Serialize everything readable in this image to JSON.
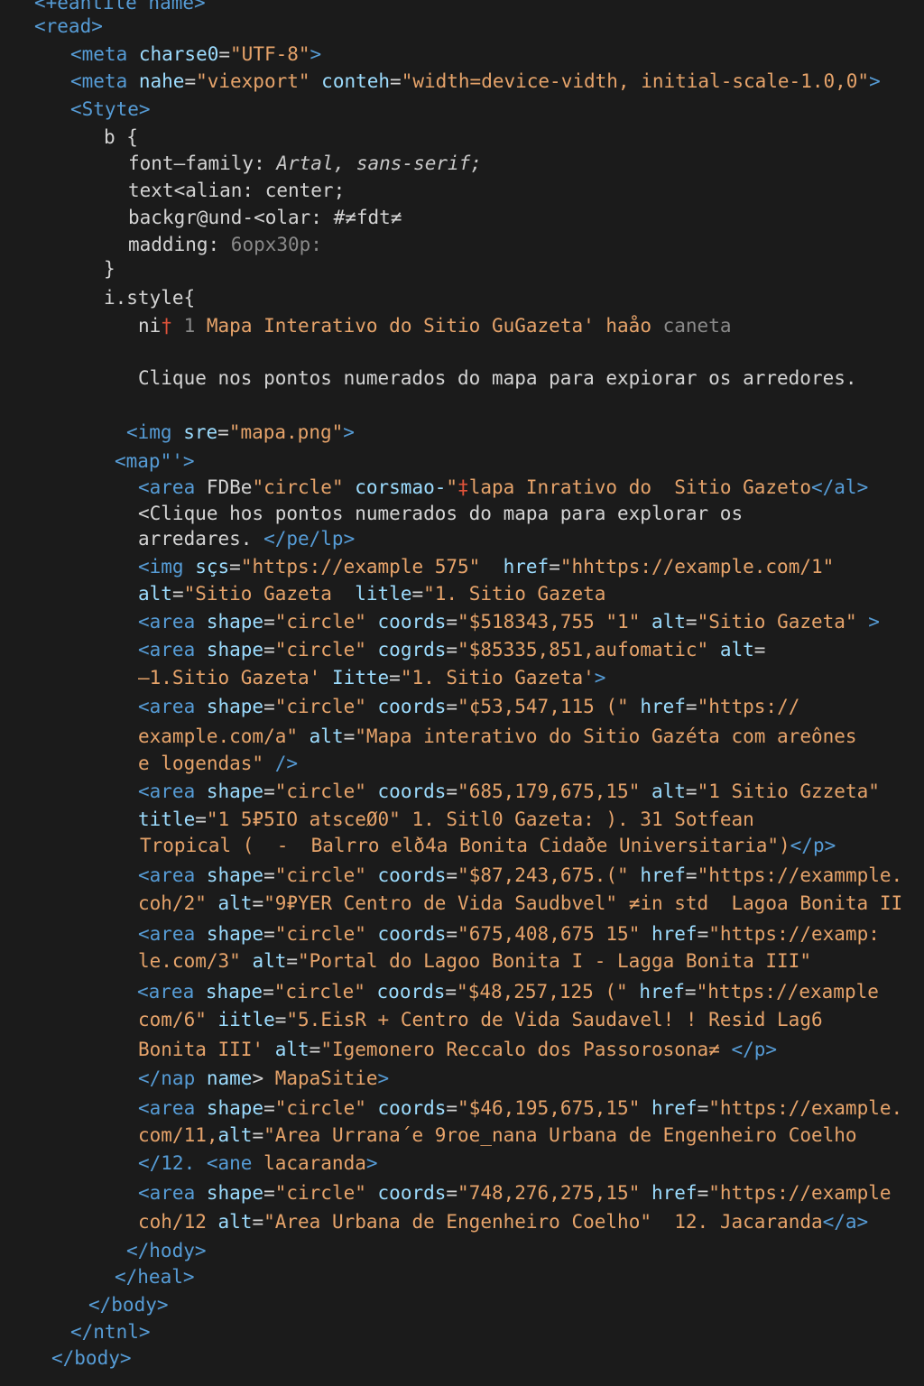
{
  "editor": {
    "lines": [
      {
        "segs": [
          {
            "c": "t",
            "t": "<+eantile name>"
          }
        ]
      },
      {
        "segs": [
          {
            "c": "t",
            "t": "<read>"
          }
        ]
      },
      {
        "segs": [
          {
            "c": "t",
            "t": "<meta "
          },
          {
            "c": "a",
            "t": "charse0"
          },
          {
            "c": "p",
            "t": "="
          },
          {
            "c": "s",
            "t": "\"UTF-8\""
          },
          {
            "c": "t",
            "t": ">"
          }
        ]
      },
      {
        "segs": [
          {
            "c": "t",
            "t": "<meta "
          },
          {
            "c": "a",
            "t": "nahe"
          },
          {
            "c": "p",
            "t": "="
          },
          {
            "c": "s",
            "t": "\"viexport\" "
          },
          {
            "c": "a",
            "t": "conteh"
          },
          {
            "c": "p",
            "t": "="
          },
          {
            "c": "s",
            "t": "\"width=device-vidth, initial-scale-1.0,0\""
          },
          {
            "c": "t",
            "t": ">"
          }
        ]
      },
      {
        "segs": [
          {
            "c": "t",
            "t": "<Styte>"
          }
        ]
      },
      {
        "segs": [
          {
            "c": "p",
            "t": "b {"
          }
        ]
      },
      {
        "segs": [
          {
            "c": "p",
            "t": "font—family: "
          },
          {
            "c": "i",
            "t": "Artal, sans-serif;"
          }
        ]
      },
      {
        "segs": [
          {
            "c": "p",
            "t": "text<alian: center;"
          }
        ]
      },
      {
        "segs": [
          {
            "c": "p",
            "t": "backgr@und-<olar: #≠fdt≠"
          }
        ]
      },
      {
        "segs": [
          {
            "c": "p",
            "t": "madding: "
          },
          {
            "c": "g",
            "t": "6opx30p:"
          }
        ]
      },
      {
        "segs": [
          {
            "c": "p",
            "t": "}"
          }
        ]
      },
      {
        "segs": [
          {
            "c": "p",
            "t": "i.style{"
          }
        ]
      },
      {
        "segs": [
          {
            "c": "p",
            "t": "ni"
          },
          {
            "c": "r",
            "t": "†"
          },
          {
            "c": "g",
            "t": " 1 "
          },
          {
            "c": "s",
            "t": "Mapa Interativo do Sitio GuGazeta' haåo "
          },
          {
            "c": "g",
            "t": "caneta"
          }
        ]
      },
      {
        "segs": [
          {
            "c": "p",
            "t": "Clique nos pontos numerados do mapa para expiorar os arredores."
          }
        ]
      },
      {
        "segs": [
          {
            "c": "t",
            "t": "<img "
          },
          {
            "c": "a",
            "t": "sre"
          },
          {
            "c": "p",
            "t": "="
          },
          {
            "c": "s",
            "t": "\"mapa.png\""
          },
          {
            "c": "t",
            "t": ">"
          }
        ]
      },
      {
        "segs": [
          {
            "c": "t",
            "t": "<map\"'>"
          }
        ]
      },
      {
        "segs": [
          {
            "c": "t",
            "t": "<area "
          },
          {
            "c": "p",
            "t": "FDBe"
          },
          {
            "c": "s",
            "t": "\"circle\" "
          },
          {
            "c": "a",
            "t": "corsmao-"
          },
          {
            "c": "s",
            "t": "\""
          },
          {
            "c": "r",
            "t": "‡"
          },
          {
            "c": "s",
            "t": "lapa Inrativo do  Sitio Gazeto"
          },
          {
            "c": "t",
            "t": "</al>"
          }
        ]
      },
      {
        "segs": [
          {
            "c": "p",
            "t": "<Clique hos pontos numerados do mapa para explorar os"
          }
        ]
      },
      {
        "segs": [
          {
            "c": "p",
            "t": "arredares. "
          },
          {
            "c": "t",
            "t": "</pe/lp>"
          }
        ]
      },
      {
        "segs": [
          {
            "c": "t",
            "t": "<img "
          },
          {
            "c": "a",
            "t": "sçs"
          },
          {
            "c": "p",
            "t": "="
          },
          {
            "c": "s",
            "t": "\"https://example 575\"  "
          },
          {
            "c": "a",
            "t": "href"
          },
          {
            "c": "p",
            "t": "="
          },
          {
            "c": "s",
            "t": "\"hhttps://example.com/1\""
          }
        ]
      },
      {
        "segs": [
          {
            "c": "a",
            "t": "alt"
          },
          {
            "c": "p",
            "t": "="
          },
          {
            "c": "s",
            "t": "\"Sitio Gazeta  "
          },
          {
            "c": "a",
            "t": "litle"
          },
          {
            "c": "p",
            "t": "="
          },
          {
            "c": "s",
            "t": "\"1. Sitio Gazeta"
          }
        ]
      },
      {
        "segs": [
          {
            "c": "t",
            "t": "<area "
          },
          {
            "c": "a",
            "t": "shape"
          },
          {
            "c": "p",
            "t": "="
          },
          {
            "c": "s",
            "t": "\"circle\" "
          },
          {
            "c": "a",
            "t": "coords"
          },
          {
            "c": "p",
            "t": "="
          },
          {
            "c": "s",
            "t": "\"$518343,755 \"1\" "
          },
          {
            "c": "a",
            "t": "alt"
          },
          {
            "c": "p",
            "t": "="
          },
          {
            "c": "s",
            "t": "\"Sitio Gazeta\" "
          },
          {
            "c": "t",
            "t": ">"
          }
        ]
      },
      {
        "segs": [
          {
            "c": "t",
            "t": "<area "
          },
          {
            "c": "a",
            "t": "shape"
          },
          {
            "c": "p",
            "t": "="
          },
          {
            "c": "s",
            "t": "\"circle\" "
          },
          {
            "c": "a",
            "t": "cogrds"
          },
          {
            "c": "p",
            "t": "="
          },
          {
            "c": "s",
            "t": "\"$85335,851,aufomatic\" "
          },
          {
            "c": "a",
            "t": "alt"
          },
          {
            "c": "p",
            "t": "="
          }
        ]
      },
      {
        "segs": [
          {
            "c": "s",
            "t": "–1.Sitio Gazeta' "
          },
          {
            "c": "a",
            "t": "Iitte"
          },
          {
            "c": "p",
            "t": "="
          },
          {
            "c": "s",
            "t": "\"1. Sitio Gazeta'"
          },
          {
            "c": "t",
            "t": ">"
          }
        ]
      },
      {
        "segs": [
          {
            "c": "t",
            "t": "<area "
          },
          {
            "c": "a",
            "t": "shape"
          },
          {
            "c": "p",
            "t": "="
          },
          {
            "c": "s",
            "t": "\"circle\" "
          },
          {
            "c": "a",
            "t": "coords"
          },
          {
            "c": "p",
            "t": "="
          },
          {
            "c": "s",
            "t": "\"¢53,547,115 (\" "
          },
          {
            "c": "a",
            "t": "href"
          },
          {
            "c": "p",
            "t": "="
          },
          {
            "c": "s",
            "t": "\"https://"
          }
        ]
      },
      {
        "segs": [
          {
            "c": "s",
            "t": "example.com/a\" "
          },
          {
            "c": "a",
            "t": "alt"
          },
          {
            "c": "p",
            "t": "="
          },
          {
            "c": "s",
            "t": "\"Mapa interativo do Sitio Gazéta com areônes"
          }
        ]
      },
      {
        "segs": [
          {
            "c": "s",
            "t": "e logendas\" "
          },
          {
            "c": "t",
            "t": "/>"
          }
        ]
      },
      {
        "segs": [
          {
            "c": "t",
            "t": "<area "
          },
          {
            "c": "a",
            "t": "shape"
          },
          {
            "c": "p",
            "t": "="
          },
          {
            "c": "s",
            "t": "\"circle\" "
          },
          {
            "c": "a",
            "t": "coords"
          },
          {
            "c": "p",
            "t": "="
          },
          {
            "c": "s",
            "t": "\"685,179,675,15\" "
          },
          {
            "c": "a",
            "t": "alt"
          },
          {
            "c": "p",
            "t": "="
          },
          {
            "c": "s",
            "t": "\"1 Sitio Gzzeta\""
          }
        ]
      },
      {
        "segs": [
          {
            "c": "a",
            "t": "title"
          },
          {
            "c": "p",
            "t": "="
          },
          {
            "c": "s",
            "t": "\"1 5₽5IO atsceØ0\" 1. Sitl0 Gazeta: ). 31 Sotfean"
          }
        ]
      },
      {
        "segs": [
          {
            "c": "s",
            "t": "Tropical (  -  Balrro elð4a Bonita Cidaðe Universitaria\")"
          },
          {
            "c": "t",
            "t": "</p>"
          }
        ]
      },
      {
        "segs": [
          {
            "c": "t",
            "t": "<area "
          },
          {
            "c": "a",
            "t": "shape"
          },
          {
            "c": "p",
            "t": "="
          },
          {
            "c": "s",
            "t": "\"circle\" "
          },
          {
            "c": "a",
            "t": "coords"
          },
          {
            "c": "p",
            "t": "="
          },
          {
            "c": "s",
            "t": "\"$87,243,675.(\" "
          },
          {
            "c": "a",
            "t": "href"
          },
          {
            "c": "p",
            "t": "="
          },
          {
            "c": "s",
            "t": "\"https://exammple."
          }
        ]
      },
      {
        "segs": [
          {
            "c": "s",
            "t": "coh/2\" "
          },
          {
            "c": "a",
            "t": "alt"
          },
          {
            "c": "p",
            "t": "="
          },
          {
            "c": "s",
            "t": "\"9₽YER Centro de Vida Saudbvel\" ≠in std  Lagoa Bonita II"
          }
        ]
      },
      {
        "segs": [
          {
            "c": "t",
            "t": "<area "
          },
          {
            "c": "a",
            "t": "shape"
          },
          {
            "c": "p",
            "t": "="
          },
          {
            "c": "s",
            "t": "\"circle\" "
          },
          {
            "c": "a",
            "t": "coords"
          },
          {
            "c": "p",
            "t": "="
          },
          {
            "c": "s",
            "t": "\"675,408,675 15\" "
          },
          {
            "c": "a",
            "t": "href"
          },
          {
            "c": "p",
            "t": "="
          },
          {
            "c": "s",
            "t": "\"https://examp:"
          }
        ]
      },
      {
        "segs": [
          {
            "c": "s",
            "t": "le.com/3\" "
          },
          {
            "c": "a",
            "t": "alt"
          },
          {
            "c": "p",
            "t": "="
          },
          {
            "c": "s",
            "t": "\"Portal do Lagoo Bonita I - Lagga Bonita III\""
          }
        ]
      },
      {
        "segs": [
          {
            "c": "t",
            "t": "<area "
          },
          {
            "c": "a",
            "t": "shape"
          },
          {
            "c": "p",
            "t": "="
          },
          {
            "c": "s",
            "t": "\"circle\" "
          },
          {
            "c": "a",
            "t": "coords"
          },
          {
            "c": "p",
            "t": "="
          },
          {
            "c": "s",
            "t": "\"$48,257,125 (\" "
          },
          {
            "c": "a",
            "t": "href"
          },
          {
            "c": "p",
            "t": "="
          },
          {
            "c": "s",
            "t": "\"https://example"
          }
        ]
      },
      {
        "segs": [
          {
            "c": "s",
            "t": "com/6\" "
          },
          {
            "c": "a",
            "t": "iitle"
          },
          {
            "c": "p",
            "t": "="
          },
          {
            "c": "s",
            "t": "\"5.EisR + Centro de Vida Saudavel! ! Resid Lag6"
          }
        ]
      },
      {
        "segs": [
          {
            "c": "s",
            "t": "Bonita III' "
          },
          {
            "c": "a",
            "t": "alt"
          },
          {
            "c": "p",
            "t": "="
          },
          {
            "c": "s",
            "t": "\"Igemonero Reccalo dos Passorosona≠ "
          },
          {
            "c": "t",
            "t": "</p>"
          }
        ]
      },
      {
        "segs": [
          {
            "c": "t",
            "t": "</nap "
          },
          {
            "c": "a",
            "t": "name"
          },
          {
            "c": "p",
            "t": "> "
          },
          {
            "c": "s",
            "t": "MapaSitie"
          },
          {
            "c": "t",
            "t": ">"
          }
        ]
      },
      {
        "segs": [
          {
            "c": "t",
            "t": "<area "
          },
          {
            "c": "a",
            "t": "shape"
          },
          {
            "c": "p",
            "t": "="
          },
          {
            "c": "s",
            "t": "\"circle\" "
          },
          {
            "c": "a",
            "t": "coords"
          },
          {
            "c": "p",
            "t": "="
          },
          {
            "c": "s",
            "t": "\"$46,195,675,15\" "
          },
          {
            "c": "a",
            "t": "href"
          },
          {
            "c": "p",
            "t": "="
          },
          {
            "c": "s",
            "t": "\"https://example."
          }
        ]
      },
      {
        "segs": [
          {
            "c": "s",
            "t": "com/11,"
          },
          {
            "c": "a",
            "t": "alt"
          },
          {
            "c": "p",
            "t": "="
          },
          {
            "c": "s",
            "t": "\"Area Urrana´e 9roe_nana Urbana de Engenheiro Coelho"
          }
        ]
      },
      {
        "segs": [
          {
            "c": "t",
            "t": "</12. <ane "
          },
          {
            "c": "s",
            "t": "lacaranda"
          },
          {
            "c": "t",
            "t": ">"
          }
        ]
      },
      {
        "segs": [
          {
            "c": "t",
            "t": "<area "
          },
          {
            "c": "a",
            "t": "shape"
          },
          {
            "c": "p",
            "t": "="
          },
          {
            "c": "s",
            "t": "\"circle\" "
          },
          {
            "c": "a",
            "t": "coords"
          },
          {
            "c": "p",
            "t": "="
          },
          {
            "c": "s",
            "t": "\"748,276,275,15\" "
          },
          {
            "c": "a",
            "t": "href"
          },
          {
            "c": "p",
            "t": "="
          },
          {
            "c": "s",
            "t": "\"https://example"
          }
        ]
      },
      {
        "segs": [
          {
            "c": "s",
            "t": "coh/12 "
          },
          {
            "c": "a",
            "t": "alt"
          },
          {
            "c": "p",
            "t": "="
          },
          {
            "c": "s",
            "t": "\"Area Urbana de Engenheiro Coelho\"  12. Jacaranda"
          },
          {
            "c": "t",
            "t": "</a>"
          }
        ]
      },
      {
        "segs": [
          {
            "c": "t",
            "t": "</hody>"
          }
        ]
      },
      {
        "segs": [
          {
            "c": "t",
            "t": "</heal>"
          }
        ]
      },
      {
        "segs": [
          {
            "c": "t",
            "t": "</body>"
          }
        ]
      },
      {
        "segs": [
          {
            "c": "t",
            "t": "</ntnl>"
          }
        ]
      },
      {
        "segs": [
          {
            "c": "t",
            "t": "</body>"
          }
        ]
      }
    ]
  },
  "colors": {
    "background": "#1b1b1b",
    "tag": "#569cd6",
    "attribute": "#9cdcfe",
    "value": "#e6a36a",
    "text": "#d4d4d4",
    "error_mark": "#e0533a"
  }
}
